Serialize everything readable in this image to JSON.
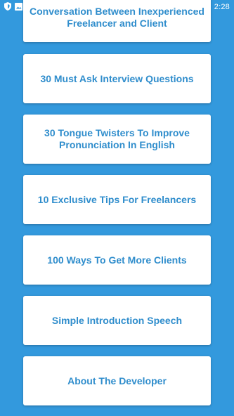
{
  "status_bar": {
    "time": "2:28",
    "icons": [
      "shield-icon",
      "image-icon",
      "wifi-icon",
      "signal-icon",
      "battery-icon"
    ]
  },
  "cards": [
    {
      "title": "Conversation Between Inexperienced Freelancer and Client"
    },
    {
      "title": "30 Must Ask Interview Questions"
    },
    {
      "title": "30 Tongue Twisters To Improve Pronunciation In English"
    },
    {
      "title": "10 Exclusive Tips For Freelancers"
    },
    {
      "title": "100 Ways To Get More Clients"
    },
    {
      "title": "Simple Introduction Speech"
    },
    {
      "title": "About The Developer"
    }
  ],
  "colors": {
    "background": "#3399dd",
    "card": "#ffffff",
    "title_text": "#2f8dcc"
  }
}
